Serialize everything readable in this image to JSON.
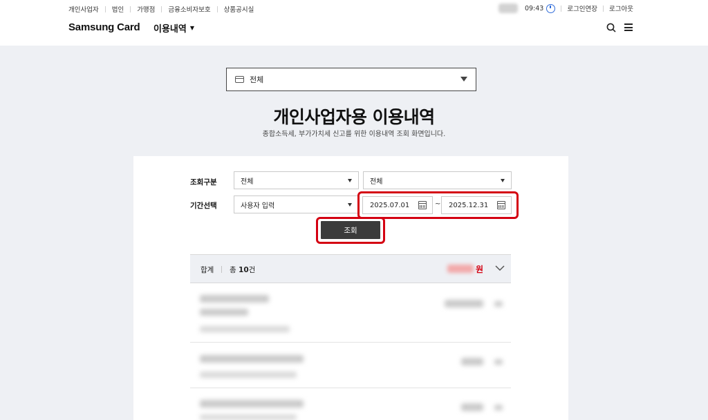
{
  "util_nav": {
    "items": [
      "개인사업자",
      "법인",
      "가맹점",
      "금융소비자보호",
      "상품공시실"
    ],
    "time": "09:43",
    "extend_login": "로그인연장",
    "logout": "로그아웃"
  },
  "header": {
    "brand": "Samsung Card",
    "menu_title": "이용내역"
  },
  "card_selector": {
    "value": "전체"
  },
  "page": {
    "title": "개인사업자용 이용내역",
    "subtitle": "종합소득세, 부가가치세 신고를 위한 이용내역 조회 화면입니다."
  },
  "filters": {
    "category_label": "조회구분",
    "category_select_1": "전체",
    "category_select_2": "전체",
    "period_label": "기간선택",
    "period_select": "사용자 입력",
    "start_date": "2025.07.01",
    "date_separator": "~",
    "end_date": "2025.12.31",
    "search_button": "조회"
  },
  "summary": {
    "label": "합계",
    "count_prefix": "총",
    "count_value": "10",
    "count_suffix": "건",
    "currency": "원"
  },
  "colors": {
    "highlight": "#d40011",
    "button_bg": "#3b3b3b",
    "background": "#eef0f4"
  }
}
